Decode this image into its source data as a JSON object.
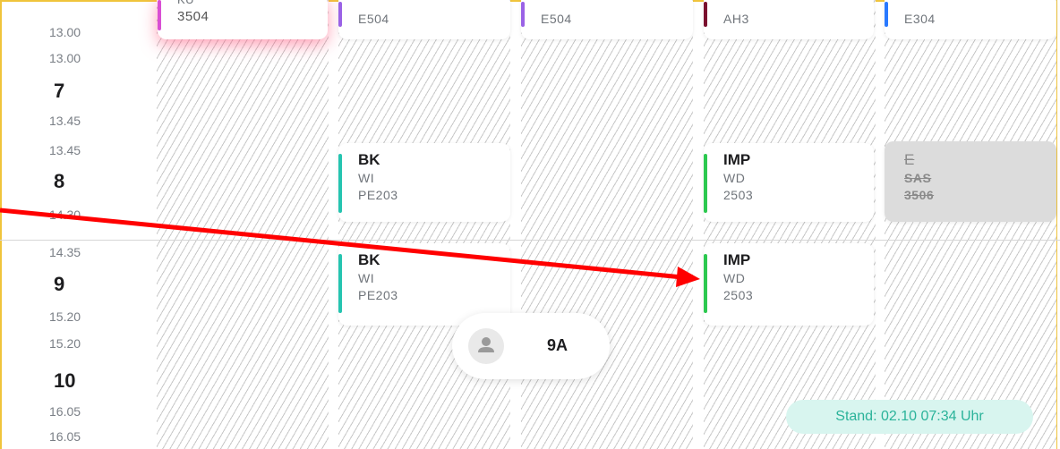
{
  "time_column": {
    "slots": [
      {
        "start": "",
        "end": "13.00",
        "number": ""
      },
      {
        "start": "13.00",
        "end": "13.45",
        "number": "7"
      },
      {
        "start": "13.45",
        "end": "14.30",
        "number": "8"
      },
      {
        "start": "14.35",
        "end": "15.20",
        "number": "9"
      },
      {
        "start": "15.20",
        "end": "16.05",
        "number": "10"
      },
      {
        "start": "16.05",
        "end": "",
        "number": ""
      }
    ]
  },
  "cards": {
    "top": [
      {
        "subject": "KU",
        "room": "3504",
        "color": "#d94fd4"
      },
      {
        "subject": "",
        "room": "E504",
        "color": "#9a62e6"
      },
      {
        "subject": "",
        "room": "E504",
        "color": "#9a62e6"
      },
      {
        "subject": "",
        "room": "AH3",
        "color": "#7a0f2e"
      },
      {
        "subject": "",
        "room": "E304",
        "color": "#2979ff"
      }
    ],
    "p8": [
      {
        "subject": "BK",
        "teacher": "WI",
        "room": "PE203",
        "color": "#25c4b0"
      },
      {
        "subject": "IMP",
        "teacher": "WD",
        "room": "2503",
        "color": "#2cc84f"
      },
      {
        "subject": "E",
        "teacher": "SAS",
        "room": "3506",
        "color": "#bbbbbb",
        "cancelled": true
      }
    ],
    "p9": [
      {
        "subject": "BK",
        "teacher": "WI",
        "room": "PE203",
        "color": "#25c4b0"
      },
      {
        "subject": "IMP",
        "teacher": "WD",
        "room": "2503",
        "color": "#2cc84f"
      }
    ]
  },
  "class_selector": {
    "label": "9A",
    "icon": "person-icon"
  },
  "status": {
    "stand": "Stand: 02.10 07:34 Uhr"
  },
  "colors": {
    "border": "#f0c43c",
    "annotation": "#ff0000",
    "status_bg": "#d8f5ef",
    "status_text": "#2bb39a"
  }
}
